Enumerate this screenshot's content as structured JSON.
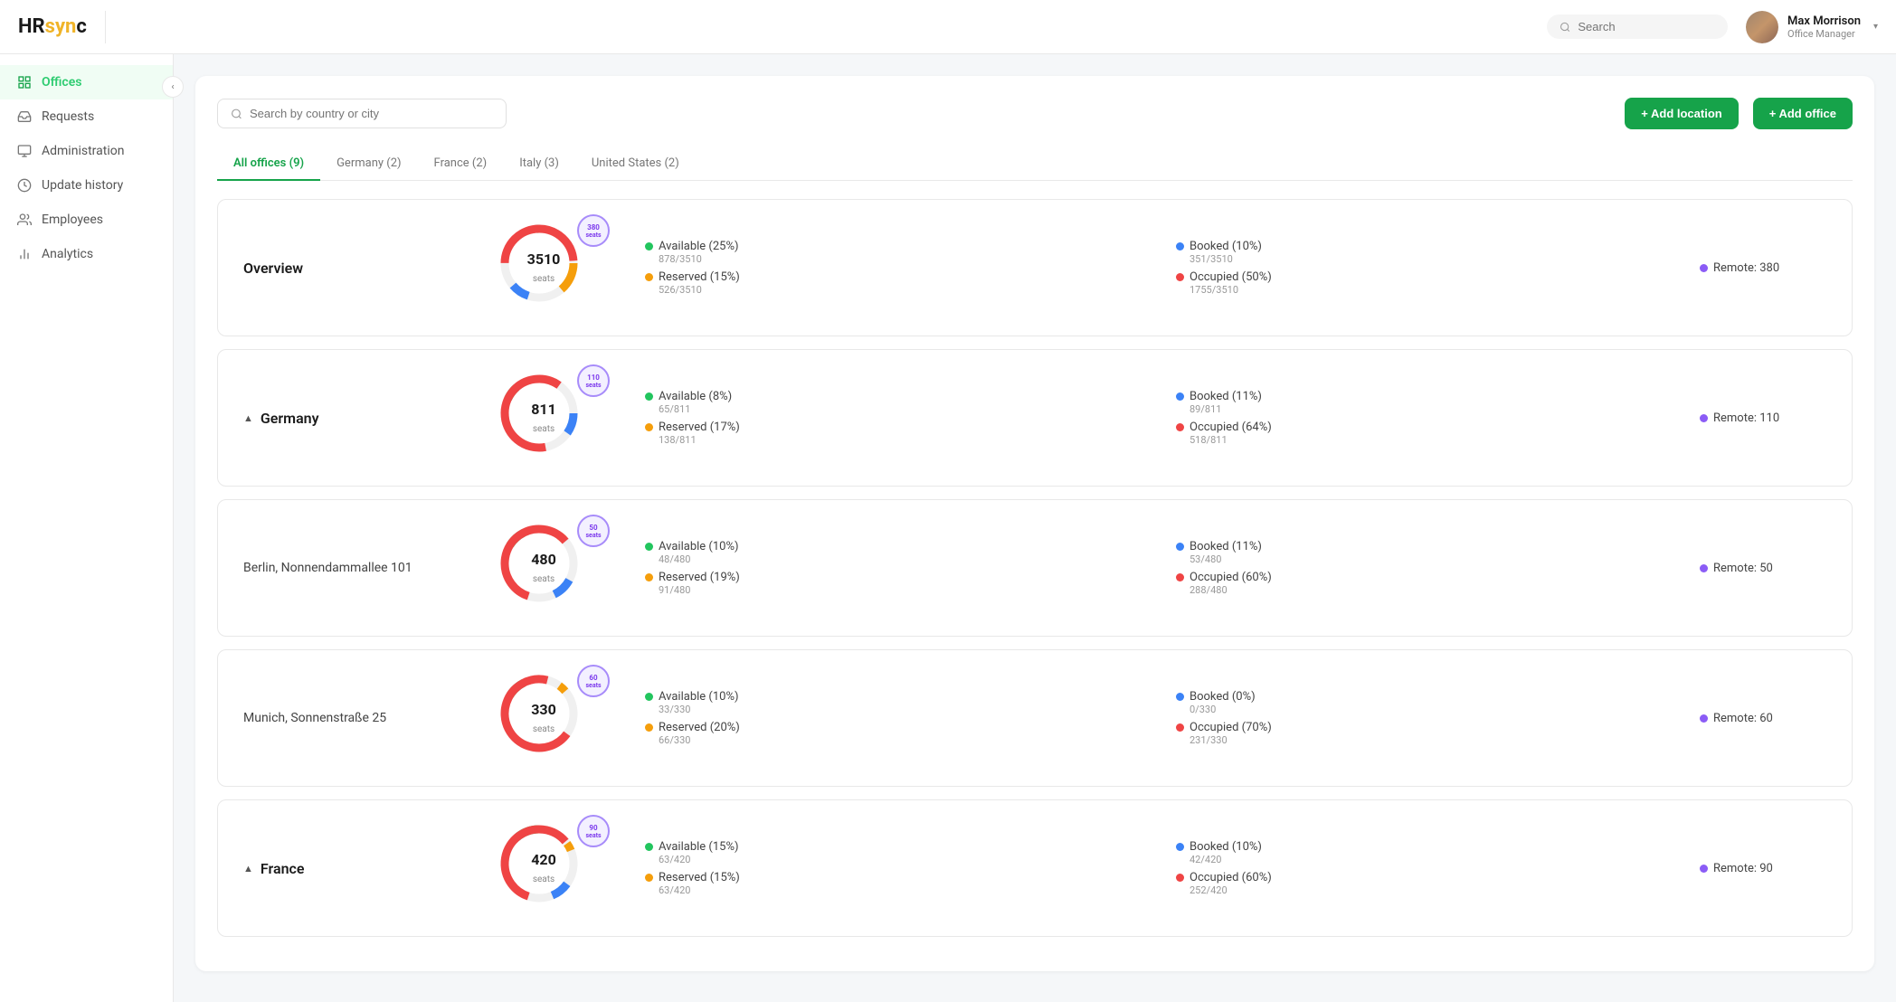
{
  "app": {
    "logo": "HRsync",
    "logo_dot": "·"
  },
  "header": {
    "search_placeholder": "Search",
    "user": {
      "name": "Max Morrison",
      "role": "Office Manager"
    }
  },
  "sidebar": {
    "collapse_icon": "‹",
    "items": [
      {
        "id": "offices",
        "label": "Offices",
        "icon": "grid",
        "active": true
      },
      {
        "id": "requests",
        "label": "Requests",
        "icon": "inbox",
        "active": false
      },
      {
        "id": "administration",
        "label": "Administration",
        "icon": "settings",
        "active": false
      },
      {
        "id": "update-history",
        "label": "Update history",
        "icon": "clock",
        "active": false
      },
      {
        "id": "employees",
        "label": "Employees",
        "icon": "users",
        "active": false
      },
      {
        "id": "analytics",
        "label": "Analytics",
        "icon": "bar-chart",
        "active": false
      }
    ]
  },
  "toolbar": {
    "search_placeholder": "Search by country or city",
    "add_location_label": "+ Add location",
    "add_office_label": "+ Add office"
  },
  "tabs": [
    {
      "id": "all",
      "label": "All offices (9)",
      "active": true
    },
    {
      "id": "germany",
      "label": "Germany (2)",
      "active": false
    },
    {
      "id": "france",
      "label": "France (2)",
      "active": false
    },
    {
      "id": "italy",
      "label": "Italy (3)",
      "active": false
    },
    {
      "id": "us",
      "label": "United States (2)",
      "active": false
    }
  ],
  "rows": [
    {
      "id": "overview",
      "title": "Overview",
      "expand_icon": null,
      "seats": 3510,
      "remote": 380,
      "donut": [
        {
          "label": "Available",
          "pct": 25,
          "color": "#22c55e",
          "count": "878/3510"
        },
        {
          "label": "Reserved",
          "pct": 15,
          "color": "#f59e0b",
          "count": "526/3510"
        },
        {
          "label": "Booked",
          "pct": 10,
          "color": "#3b82f6",
          "count": "351/3510"
        },
        {
          "label": "Occupied",
          "pct": 50,
          "color": "#ef4444",
          "count": "1755/3510"
        }
      ]
    },
    {
      "id": "germany",
      "title": "Germany",
      "expand_icon": "▲",
      "seats": 811,
      "remote": 110,
      "donut": [
        {
          "label": "Available",
          "pct": 8,
          "color": "#22c55e",
          "count": "65/811"
        },
        {
          "label": "Reserved",
          "pct": 17,
          "color": "#f59e0b",
          "count": "138/811"
        },
        {
          "label": "Booked",
          "pct": 11,
          "color": "#3b82f6",
          "count": "89/811"
        },
        {
          "label": "Occupied",
          "pct": 64,
          "color": "#ef4444",
          "count": "518/811"
        }
      ]
    },
    {
      "id": "berlin",
      "title": "Berlin, Nonnendammallee 101",
      "expand_icon": null,
      "sub": true,
      "seats": 480,
      "remote": 50,
      "donut": [
        {
          "label": "Available",
          "pct": 10,
          "color": "#22c55e",
          "count": "48/480"
        },
        {
          "label": "Reserved",
          "pct": 19,
          "color": "#f59e0b",
          "count": "91/480"
        },
        {
          "label": "Booked",
          "pct": 11,
          "color": "#3b82f6",
          "count": "53/480"
        },
        {
          "label": "Occupied",
          "pct": 60,
          "color": "#ef4444",
          "count": "288/480"
        }
      ]
    },
    {
      "id": "munich",
      "title": "Munich, Sonnenstraße 25",
      "expand_icon": null,
      "sub": true,
      "seats": 330,
      "remote": 60,
      "donut": [
        {
          "label": "Available",
          "pct": 10,
          "color": "#22c55e",
          "count": "33/330"
        },
        {
          "label": "Reserved",
          "pct": 20,
          "color": "#f59e0b",
          "count": "66/330"
        },
        {
          "label": "Booked",
          "pct": 0,
          "color": "#3b82f6",
          "count": "0/330"
        },
        {
          "label": "Occupied",
          "pct": 70,
          "color": "#ef4444",
          "count": "231/330"
        }
      ]
    },
    {
      "id": "france",
      "title": "France",
      "expand_icon": "▲",
      "seats": 420,
      "remote": 90,
      "donut": [
        {
          "label": "Available",
          "pct": 15,
          "color": "#22c55e",
          "count": "63/420"
        },
        {
          "label": "Reserved",
          "pct": 15,
          "color": "#f59e0b",
          "count": "63/420"
        },
        {
          "label": "Booked",
          "pct": 10,
          "color": "#3b82f6",
          "count": "42/420"
        },
        {
          "label": "Occupied",
          "pct": 60,
          "color": "#ef4444",
          "count": "252/420"
        }
      ]
    }
  ],
  "colors": {
    "green": "#22c55e",
    "amber": "#f59e0b",
    "blue": "#3b82f6",
    "red": "#ef4444",
    "purple": "#8b5cf6",
    "brand": "#16a34a"
  }
}
